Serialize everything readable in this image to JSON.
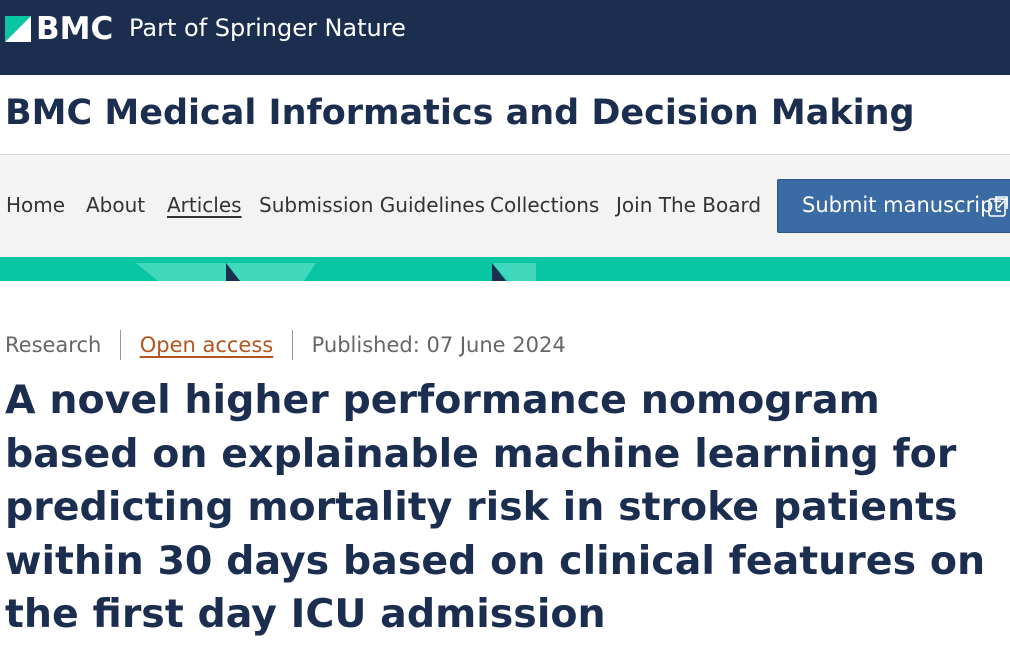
{
  "header": {
    "logo_text": "BMC",
    "springer_text": "Part of Springer Nature",
    "bg_color": "#1b2e4f"
  },
  "journal": {
    "title": "BMC Medical Informatics and Decision Making"
  },
  "nav": {
    "items": [
      {
        "label": "Home"
      },
      {
        "label": "About"
      },
      {
        "label": "Articles",
        "active": true
      },
      {
        "label": "Submission Guidelines"
      },
      {
        "label": "Collections"
      },
      {
        "label": "Join The Board"
      }
    ],
    "submit_label": "Submit manuscript",
    "submit_icon": "external-link-icon"
  },
  "accent": {
    "teal": "#08c5a3",
    "link_orange": "#b5551d",
    "button_blue": "#3b6ba4"
  },
  "article": {
    "type": "Research",
    "access": "Open access",
    "published": "Published: 07 June 2024",
    "title": "A novel higher performance nomogram based on explainable machine learning for predicting mortality risk in stroke patients within 30 days based on clinical features on the first day ICU admission"
  }
}
